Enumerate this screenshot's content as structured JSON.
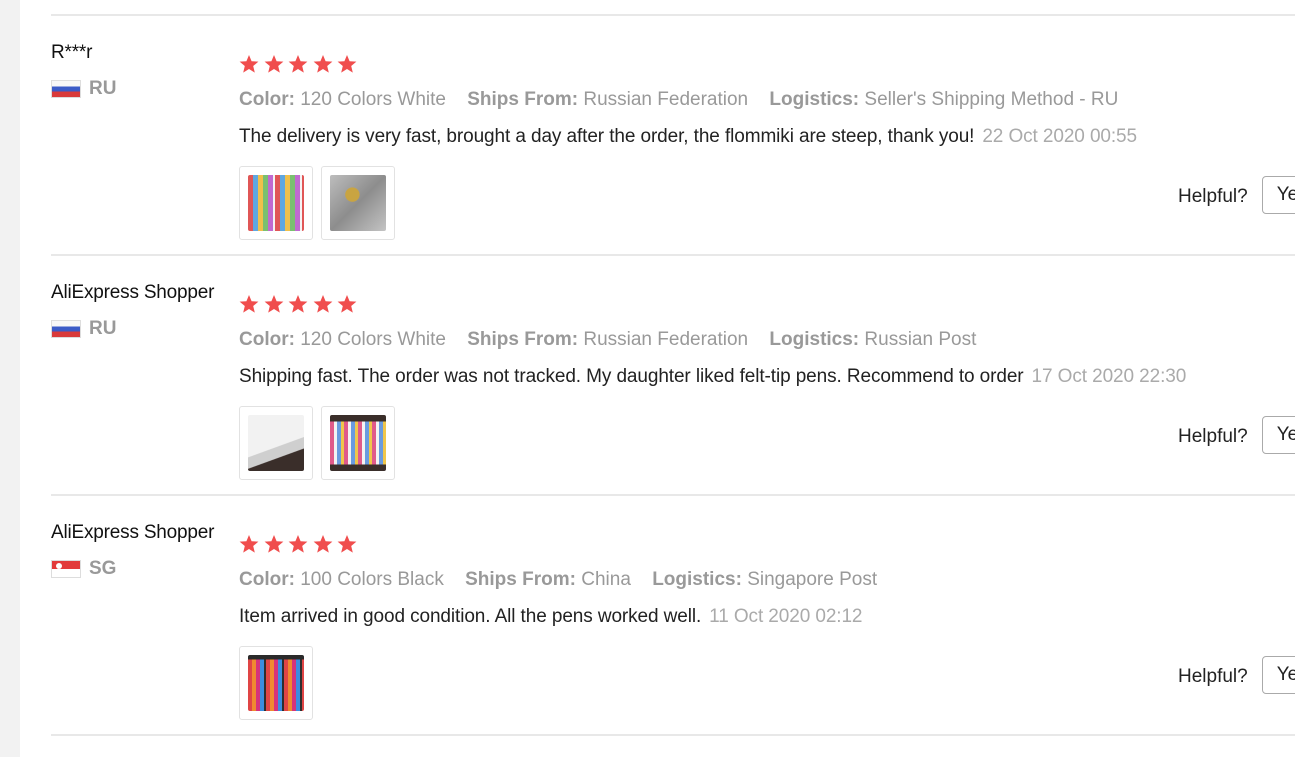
{
  "reviews": [
    {
      "user": "R***r",
      "country_code": "RU",
      "flag": "flag-ru",
      "rating": 5,
      "color_label": "Color:",
      "color_value": "120 Colors White",
      "ships_label": "Ships From:",
      "ships_value": "Russian Federation",
      "logistics_label": "Logistics:",
      "logistics_value": "Seller's Shipping Method - RU",
      "text": "The delivery is very fast, brought a day after the order, the flommiki are steep, thank you!",
      "date": "22 Oct 2020 00:55",
      "helpful_label": "Helpful?",
      "yes_label": "Yes"
    },
    {
      "user": "AliExpress Shopper",
      "country_code": "RU",
      "flag": "flag-ru",
      "rating": 5,
      "color_label": "Color:",
      "color_value": "120 Colors White",
      "ships_label": "Ships From:",
      "ships_value": "Russian Federation",
      "logistics_label": "Logistics:",
      "logistics_value": "Russian Post",
      "text": "Shipping fast. The order was not tracked. My daughter liked felt-tip pens. Recommend to order",
      "date": "17 Oct 2020 22:30",
      "helpful_label": "Helpful?",
      "yes_label": "Yes"
    },
    {
      "user": "AliExpress Shopper",
      "country_code": "SG",
      "flag": "flag-sg",
      "rating": 5,
      "color_label": "Color:",
      "color_value": "100 Colors Black",
      "ships_label": "Ships From:",
      "ships_value": "China",
      "logistics_label": "Logistics:",
      "logistics_value": "Singapore Post",
      "text": "Item arrived in good condition. All the pens worked well.",
      "date": "11 Oct 2020 02:12",
      "helpful_label": "Helpful?",
      "yes_label": "Yes"
    }
  ],
  "colors": {
    "star": "#f04d4d",
    "meta": "#999999",
    "date": "#aaaaaa",
    "divider": "#e8e8e8"
  }
}
